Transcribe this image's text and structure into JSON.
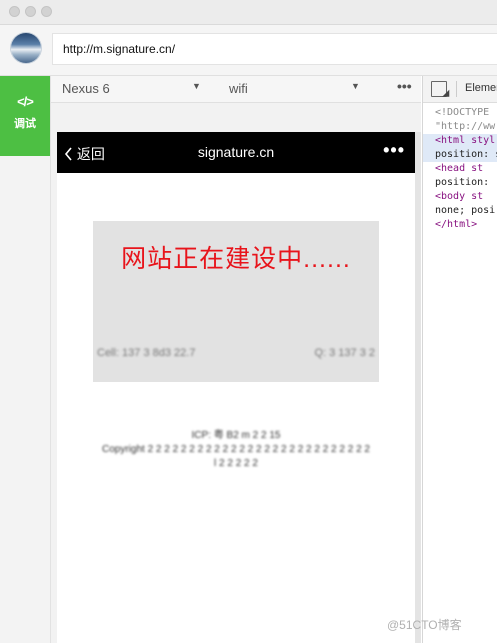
{
  "window": {
    "controls": [
      "close",
      "minimize",
      "zoom"
    ]
  },
  "address_bar": {
    "url": "http://m.signature.cn/"
  },
  "left_tools": {
    "debug_icon": "</>",
    "debug_label": "调试",
    "accent": "#4dbf43"
  },
  "simulator": {
    "device": "Nexus 6",
    "network": "wifi",
    "more": "•••",
    "caret": "▼"
  },
  "phone": {
    "back": "返回",
    "back_icon": "chevron-left",
    "title": "signature.cn",
    "more": "•••",
    "headline": "网站正在建设中......",
    "headline_color": "#e8141b",
    "banner_left": "Cell: 137 3 8d3 22.7",
    "banner_right": "Q: 3 137 3 2",
    "footer_lines": [
      "ICP: 粤 B2 m 2 2 15",
      "Copyright 2 2 2 2 2 2 2 2 2 2 2 2 2 2 2 2 2 2 2 2 2 2 2 2 2 2 2",
      "l 2 2 2 2 2"
    ]
  },
  "devtools": {
    "tab": "Elements",
    "lines": [
      {
        "text": "<!DOCTYPE",
        "kind": "gray"
      },
      {
        "text": "\"http://ww",
        "kind": "gray"
      },
      {
        "text": "<html styl",
        "kind": "tag",
        "selected": true
      },
      {
        "text": "position: st",
        "kind": "dark",
        "selected": true
      },
      {
        "text": "<head st",
        "kind": "tag"
      },
      {
        "text": "position:",
        "kind": "dark"
      },
      {
        "text": "<body st",
        "kind": "tag"
      },
      {
        "text": "none; posi",
        "kind": "dark"
      },
      {
        "text": "</html>",
        "kind": "tag"
      }
    ]
  },
  "watermark": "@51CTO博客"
}
